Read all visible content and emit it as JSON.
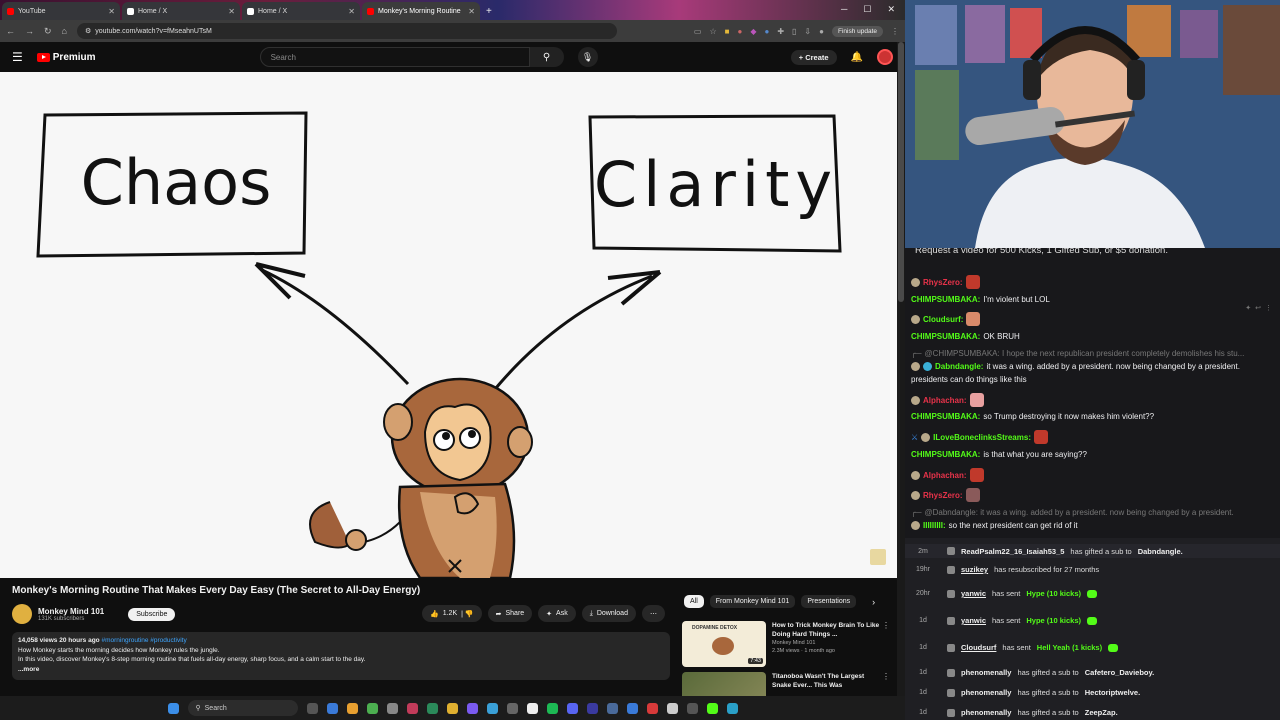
{
  "browser": {
    "tabs": [
      {
        "label": "YouTube",
        "active": false,
        "fav_color": "#ff0000"
      },
      {
        "label": "Home / X",
        "active": false,
        "fav_color": "#ffffff"
      },
      {
        "label": "Home / X",
        "active": false,
        "fav_color": "#ffffff"
      },
      {
        "label": "Monkey's Morning Routine",
        "active": true,
        "fav_color": "#ff0000"
      }
    ],
    "new_tab": "+",
    "url": "youtube.com/watch?v=fMseahnUTsM",
    "finish_update": "Finish update"
  },
  "youtube": {
    "logo_text": "Premium",
    "search_placeholder": "Search",
    "create_label": "Create",
    "video_title": "Monkey's Morning Routine That Makes Every Day Easy (The Secret to All-Day Energy)",
    "channel_name": "Monkey Mind 101",
    "channel_subs": "131K subscribers",
    "subscribe_label": "Subscribe",
    "likes": "1.2K",
    "share_label": "Share",
    "ask_label": "Ask",
    "download_label": "Download",
    "desc_stats": "14,058 views  20 hours ago",
    "desc_tags": "#morningroutine #productivity",
    "desc_line1": "How Monkey starts the morning decides how Monkey rules the jungle.",
    "desc_line2": "In this video, discover Monkey's 8-step morning routine that fuels all-day energy, sharp focus, and a calm start to the day.",
    "desc_more": "...more",
    "chips": [
      "All",
      "From Monkey Mind 101",
      "Presentations"
    ],
    "recs": [
      {
        "title": "How to Trick Monkey Brain To Like Doing Hard Things ...",
        "channel": "Monkey Mind 101",
        "stats": "2.3M views · 1 month ago",
        "duration": "7:43",
        "thumb_label": "DOPAMINE DETOX"
      },
      {
        "title": "Titanoboa Wasn't The Largest Snake Ever... This Was",
        "channel": "",
        "stats": "",
        "duration": "",
        "thumb_label": ""
      }
    ]
  },
  "video": {
    "box_left": "Chaos",
    "box_right": "Clarity"
  },
  "taskbar": {
    "search": "Search"
  },
  "chat": {
    "pinned": "Request a video for 500 Kicks, 1 Gifted Sub, or $5 donation.",
    "lines": [
      {
        "user": "RhysZero:",
        "user_color": "#e8334a",
        "text": "",
        "reply": false,
        "emote": "#c0392b"
      },
      {
        "user": "CHIMPSUMBAKA:",
        "user_color": "#53fc18",
        "text": "I'm violent but LOL",
        "reply": false,
        "emote": ""
      },
      {
        "user": "Cloudsurf:",
        "user_color": "#53fc18",
        "text": "",
        "reply": false,
        "emote": "#d98a6a"
      },
      {
        "user": "CHIMPSUMBAKA:",
        "user_color": "#53fc18",
        "text": "OK BRUH",
        "reply": false,
        "emote": ""
      },
      {
        "user": "",
        "user_color": "#777777",
        "text": "@CHIMPSUMBAKA: I hope the next republican president completely demolishes his stu...",
        "reply": true,
        "emote": ""
      },
      {
        "user": "Dabndangle:",
        "user_color": "#53fc18",
        "text": "it was a wing. added by a president. now being changed by a president.",
        "reply": false,
        "emote": ""
      },
      {
        "user": "",
        "user_color": "#efeff1",
        "text": "presidents can do things like this",
        "reply": false,
        "emote": ""
      },
      {
        "user": "Alphachan:",
        "user_color": "#e8334a",
        "text": "",
        "reply": false,
        "emote": "#e8a0a0"
      },
      {
        "user": "CHIMPSUMBAKA:",
        "user_color": "#53fc18",
        "text": "so Trump destroying it now makes him violent??",
        "reply": false,
        "emote": ""
      },
      {
        "user": "ILoveBoneclinksStreams:",
        "user_color": "#53fc18",
        "text": "",
        "reply": false,
        "emote": "#c0392b"
      },
      {
        "user": "CHIMPSUMBAKA:",
        "user_color": "#53fc18",
        "text": "is that what you are saying??",
        "reply": false,
        "emote": ""
      },
      {
        "user": "Alphachan:",
        "user_color": "#e8334a",
        "text": "",
        "reply": false,
        "emote": "#c0392b"
      },
      {
        "user": "RhysZero:",
        "user_color": "#e8334a",
        "text": "",
        "reply": false,
        "emote": "#8a5a5a"
      },
      {
        "user": "",
        "user_color": "#777777",
        "text": "@Dabndangle: it was a wing. added by a president. now being changed by a president.",
        "reply": true,
        "emote": ""
      },
      {
        "user": "IIIIIIIII:",
        "user_color": "#53fc18",
        "text": "so the next president can get rid of it",
        "reply": false,
        "emote": ""
      }
    ]
  },
  "events": [
    {
      "time": "2m",
      "name": "ReadPsalm22_16_Isaiah53_5",
      "msg": "has gifted a sub to",
      "target": "Dabndangle.",
      "hype": ""
    },
    {
      "time": "19hr",
      "name": "suzikey",
      "msg": "has resubscribed for 27 months",
      "target": "",
      "hype": ""
    },
    {
      "time": "20hr",
      "name": "yanwic",
      "msg": "has sent",
      "target": "",
      "hype": "Hype (10 kicks)"
    },
    {
      "time": "1d",
      "name": "yanwic",
      "msg": "has sent",
      "target": "",
      "hype": "Hype (10 kicks)"
    },
    {
      "time": "1d",
      "name": "Cloudsurf",
      "msg": "has sent",
      "target": "",
      "hype": "Hell Yeah (1 kicks)"
    },
    {
      "time": "1d",
      "name": "phenomenally",
      "msg": "has gifted a sub to",
      "target": "Cafetero_Davieboy.",
      "hype": ""
    },
    {
      "time": "1d",
      "name": "phenomenally",
      "msg": "has gifted a sub to",
      "target": "Hectoriptwelve.",
      "hype": ""
    },
    {
      "time": "1d",
      "name": "phenomenally",
      "msg": "has gifted a sub to",
      "target": "ZeepZap.",
      "hype": ""
    }
  ]
}
